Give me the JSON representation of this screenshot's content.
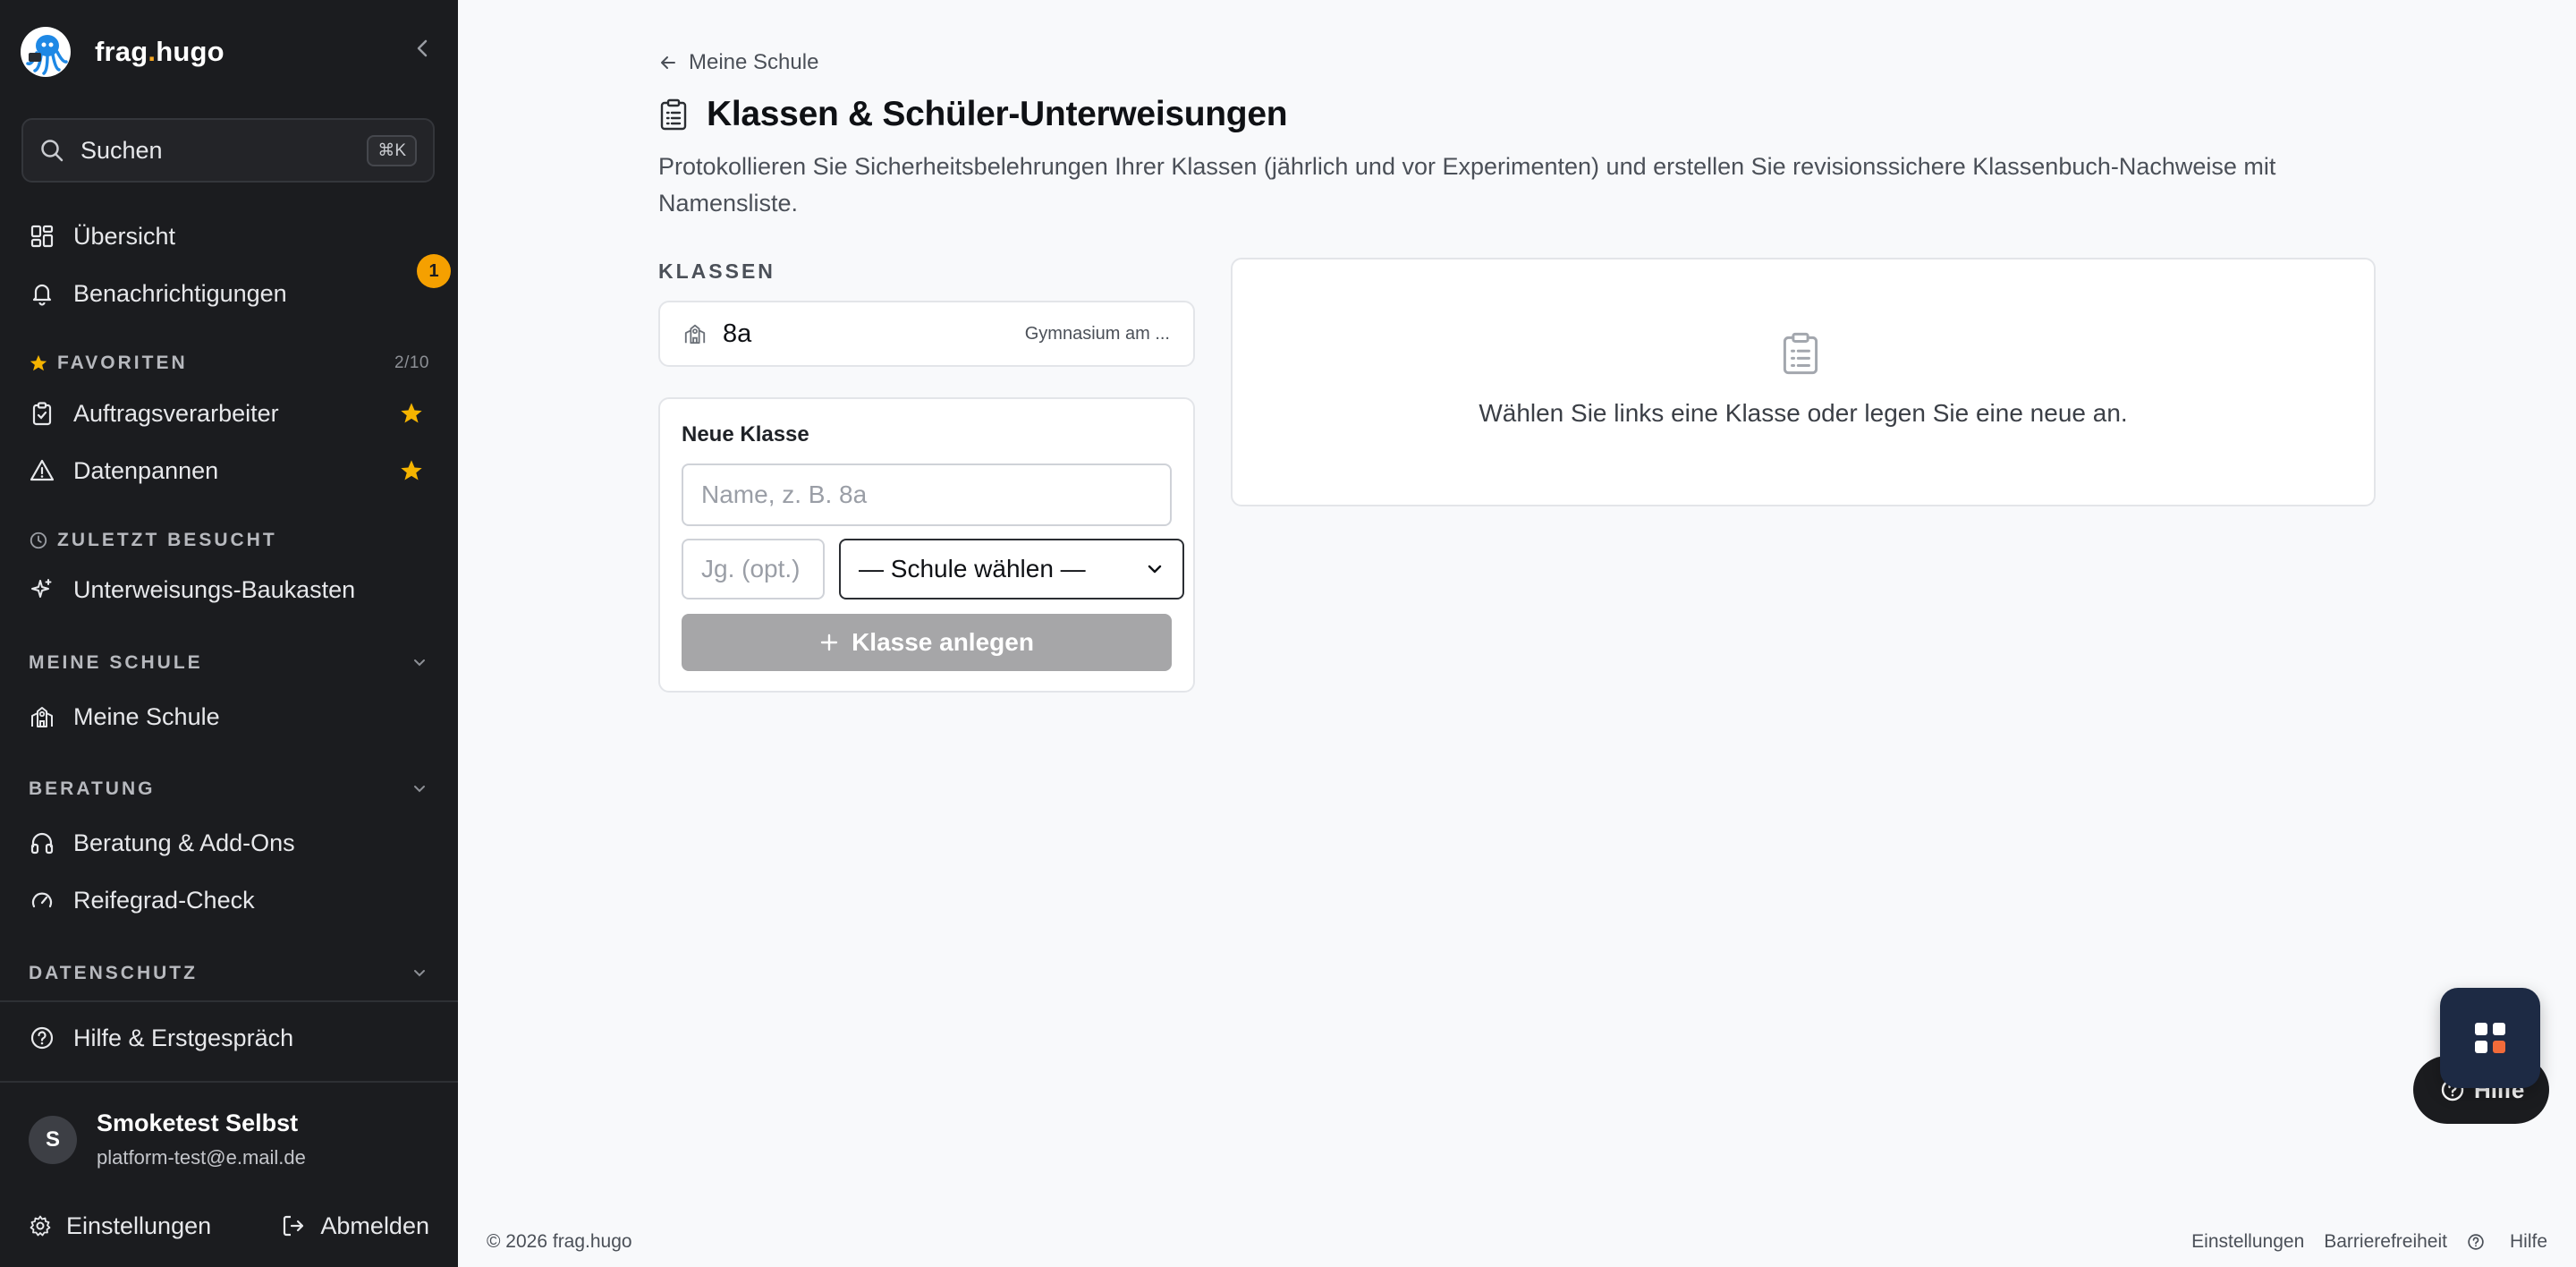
{
  "sidebar": {
    "brand": {
      "name_part1": "frag",
      "name_dot": ".",
      "name_part2": "hugo"
    },
    "search": {
      "label": "Suchen",
      "shortcut": "⌘K"
    },
    "nav": {
      "uebersicht": "Übersicht",
      "benachrichtigungen": "Benachrichtigungen",
      "notification_count": "1"
    },
    "favoriten": {
      "heading": "FAVORITEN",
      "count": "2/10",
      "items": [
        "Auftragsverarbeiter",
        "Datenpannen"
      ]
    },
    "zuletzt": {
      "heading": "ZULETZT BESUCHT",
      "items": [
        "Unterweisungs-Baukasten"
      ]
    },
    "meine_schule": {
      "heading": "MEINE SCHULE",
      "items": [
        "Meine Schule"
      ]
    },
    "beratung": {
      "heading": "BERATUNG",
      "items": [
        "Beratung & Add-Ons",
        "Reifegrad-Check"
      ]
    },
    "datenschutz": {
      "heading": "DATENSCHUTZ"
    },
    "help": "Hilfe & Erstgespräch",
    "user": {
      "initial": "S",
      "name": "Smoketest Selbst",
      "email": "platform-test@e.mail.de"
    },
    "settings": "Einstellungen",
    "logout": "Abmelden"
  },
  "main": {
    "back_label": "Meine Schule",
    "title": "Klassen & Schüler-Unterweisungen",
    "description": "Protokollieren Sie Sicherheitsbelehrungen Ihrer Klassen (jährlich und vor Experimenten) und erstellen Sie revisionssichere Klassenbuch-Nachweise mit Namensliste.",
    "klassen_heading": "KLASSEN",
    "classes": [
      {
        "name": "8a",
        "school": "Gymnasium am ..."
      }
    ],
    "new_class": {
      "heading": "Neue Klasse",
      "name_placeholder": "Name, z. B. 8a",
      "jg_placeholder": "Jg. (opt.)",
      "school_select": "— Schule wählen —",
      "add_button": "Klasse anlegen"
    },
    "empty_state": "Wählen Sie links eine Klasse oder legen Sie eine neue an."
  },
  "help_pill": "Hilfe",
  "footer": {
    "copyright": "© 2026 frag.hugo",
    "links": [
      "Einstellungen",
      "Barrierefreiheit",
      "Hilfe"
    ]
  },
  "colors": {
    "sidebar_bg": "#1b1c1f",
    "accent": "#f5a000",
    "fab_bg": "#1d2a44",
    "button_disabled": "#a6a6a8"
  }
}
